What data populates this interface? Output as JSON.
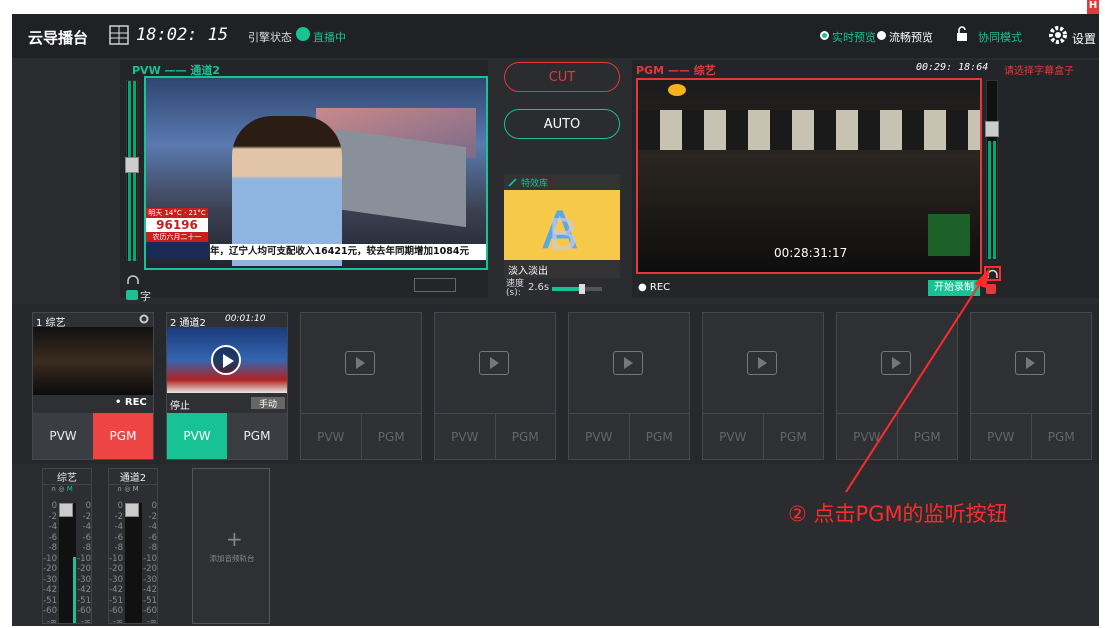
{
  "app": {
    "title": "云导播台",
    "time": "18:02: 15",
    "stream_status_label": "引擎状态",
    "stream_status": "直播中"
  },
  "header": {
    "preview_live": "实时预览",
    "preview_smooth": "流畅预览",
    "collab": "协同模式",
    "settings": "设置",
    "badge": "H"
  },
  "pvw": {
    "title": "PVW —— 通道2",
    "ticker": "年，辽宁人均可支配收入16421元，较去年同期增加1084元",
    "weather_top": "明天 14°C · 21°C",
    "weather_num": "96196",
    "weather_bottom": "农历六月二十一",
    "add_text": "字"
  },
  "pgm": {
    "title": "PGM —— 综艺",
    "timer": "00:29: 18:64",
    "subtitle_select": "请选择字幕盒子",
    "timecode": "00:28:31:17",
    "rec": "● REC",
    "start_record": "开始录制"
  },
  "center": {
    "cut": "CUT",
    "auto": "AUTO",
    "effects_title": "特效库",
    "transition": "淡入淡出",
    "speed_label": "速度(s):",
    "speed_value": "2.6s",
    "speed_fraction": 0.6
  },
  "sources": [
    {
      "title": "1 综艺",
      "rec": "• REC",
      "pvw": "PVW",
      "pgm": "PGM"
    },
    {
      "title": "2 通道2",
      "time": "00:01:10",
      "stop": "停止",
      "manual": "手动",
      "pvw": "PVW",
      "pgm": "PGM"
    },
    {
      "pvw": "PVW",
      "pgm": "PGM"
    },
    {
      "pvw": "PVW",
      "pgm": "PGM"
    },
    {
      "pvw": "PVW",
      "pgm": "PGM"
    },
    {
      "pvw": "PVW",
      "pgm": "PGM"
    },
    {
      "pvw": "PVW",
      "pgm": "PGM"
    },
    {
      "pvw": "PVW",
      "pgm": "PGM"
    }
  ],
  "audio": {
    "channels": [
      {
        "name": "综艺",
        "level": 0.55
      },
      {
        "name": "通道2",
        "level": 0
      }
    ],
    "scale": [
      "0",
      "-2",
      "-4",
      "-6",
      "-8",
      "-10",
      "-20",
      "-30",
      "-42",
      "-51",
      "-60",
      "-∞"
    ],
    "add_label": "添加音频轨台"
  },
  "annotation": {
    "text": "② 点击PGM的监听按钮",
    "color": "#ff2a2a"
  }
}
